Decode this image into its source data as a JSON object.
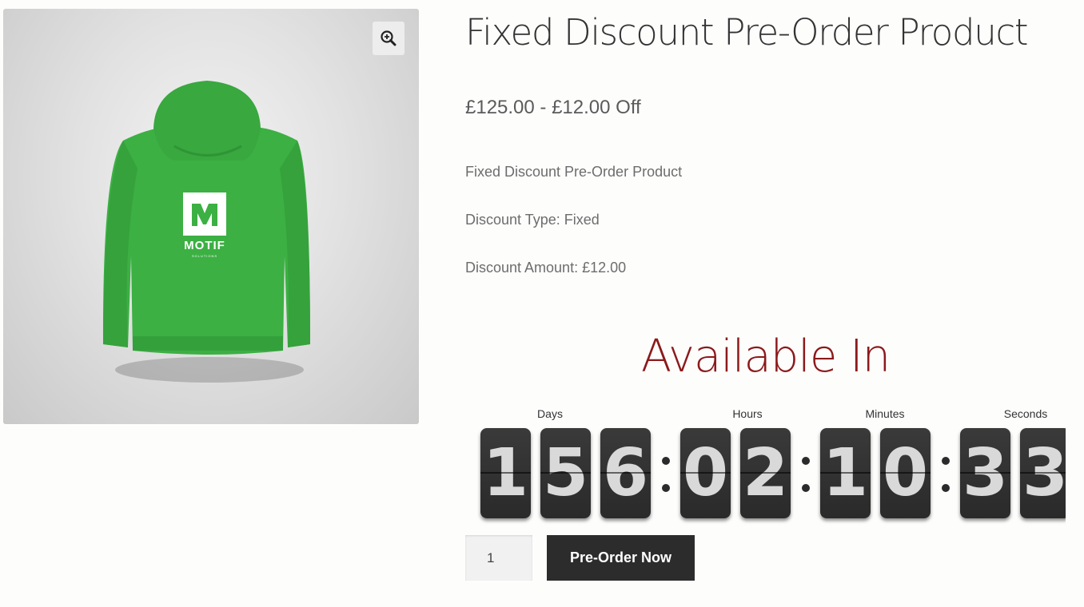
{
  "product": {
    "title": "Fixed Discount Pre-Order Product",
    "price": "£125.00 - £12.00 Off",
    "description": [
      "Fixed Discount Pre-Order Product",
      "Discount Type: Fixed",
      "Discount Amount: £12.00"
    ],
    "image": {
      "brand_text": "MOTIF",
      "brand_subtext": "SOLUTIONS",
      "hoodie_color": "#3cb043",
      "zoom_icon": "zoom-in-icon"
    }
  },
  "countdown": {
    "heading": "Available In",
    "heading_color": "#8b1a1a",
    "labels": {
      "days": "Days",
      "hours": "Hours",
      "minutes": "Minutes",
      "seconds": "Seconds"
    },
    "days": [
      "1",
      "5",
      "6"
    ],
    "hours": [
      "0",
      "2"
    ],
    "minutes": [
      "1",
      "0"
    ],
    "seconds": [
      "3",
      "3"
    ]
  },
  "cart": {
    "quantity": "1",
    "button_label": "Pre-Order Now",
    "button_color": "#2c2c2c"
  }
}
